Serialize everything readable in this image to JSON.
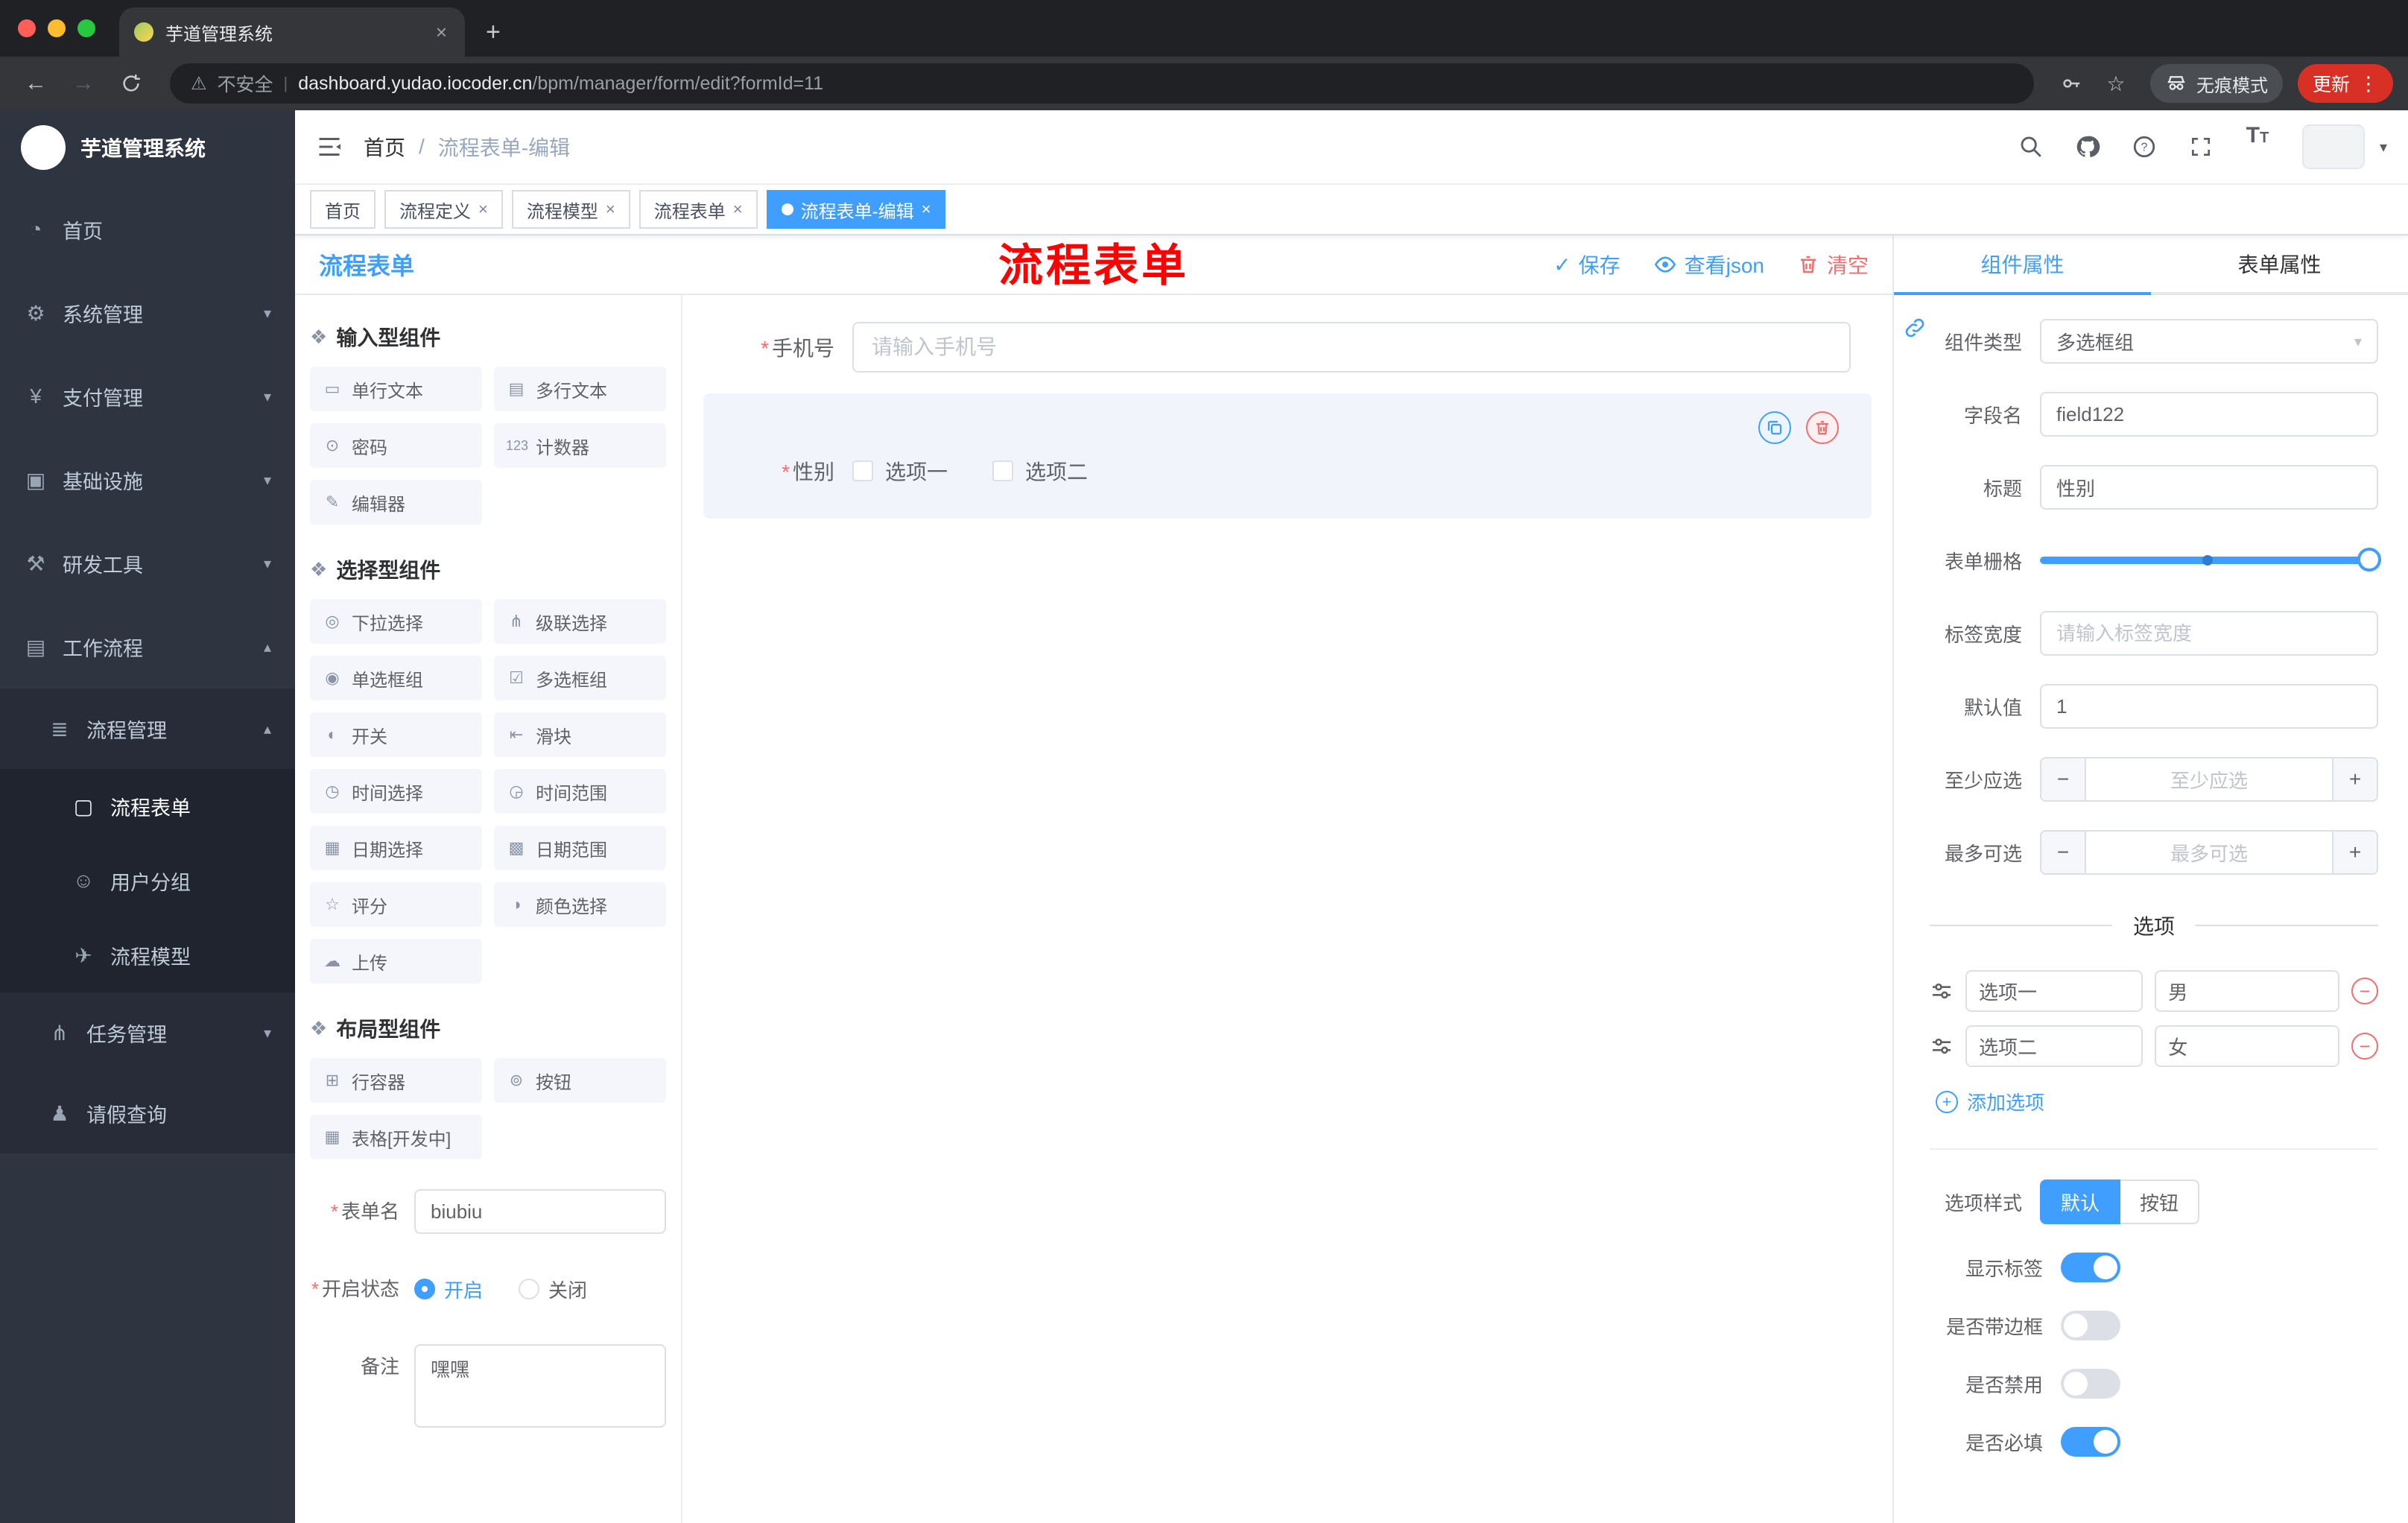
{
  "colors": {
    "accent": "#409EFF",
    "danger": "#F56C6C",
    "watermark_red": "#FF0000",
    "update_badge_red": "#D93025",
    "sidebar_bg": "#2E3440"
  },
  "ui": {
    "required": "*",
    "minus": "−",
    "plus": "+",
    "divider_bar": "|",
    "close": "×",
    "new_tab": "+",
    "dots": "⋮",
    "caret_down": "▾",
    "warning": "⚠",
    "back": "←",
    "forward": "→",
    "star": "☆",
    "check": "✓",
    "font_big": "T",
    "font_small": "T"
  },
  "browser": {
    "tab_title": "芋道管理系统",
    "security_label": "不安全",
    "url_domain": "dashboard.yudao.iocoder.cn",
    "url_path": "/bpm/manager/form/edit?formId=11",
    "incognito_label": "无痕模式",
    "update_label": "更新"
  },
  "sidebar": {
    "app_title": "芋道管理系统",
    "items": [
      {
        "label": "首页",
        "icon": "◔"
      },
      {
        "label": "系统管理",
        "icon": "⚙",
        "chevron": "▾"
      },
      {
        "label": "支付管理",
        "icon": "¥",
        "chevron": "▾"
      },
      {
        "label": "基础设施",
        "icon": "▣",
        "chevron": "▾"
      },
      {
        "label": "研发工具",
        "icon": "⚒",
        "chevron": "▾"
      },
      {
        "label": "工作流程",
        "icon": "▤",
        "chevron": "▴"
      },
      {
        "label": "流程管理",
        "icon": "≣",
        "chevron": "▴"
      },
      {
        "label": "流程表单",
        "icon": "▢"
      },
      {
        "label": "用户分组",
        "icon": "☺"
      },
      {
        "label": "流程模型",
        "icon": "✈"
      },
      {
        "label": "任务管理",
        "icon": "⋔",
        "chevron": "▾"
      },
      {
        "label": "请假查询",
        "icon": "♟"
      }
    ]
  },
  "header": {
    "breadcrumb_home": "首页",
    "breadcrumb_sep": "/",
    "breadcrumb_current": "流程表单-编辑",
    "watermark": "流程表单"
  },
  "tags": [
    {
      "label": "首页"
    },
    {
      "label": "流程定义"
    },
    {
      "label": "流程模型"
    },
    {
      "label": "流程表单"
    },
    {
      "label": "流程表单-编辑"
    }
  ],
  "designer": {
    "title": "流程表单",
    "save": "保存",
    "view_json": "查看json",
    "clear": "清空",
    "groups": [
      {
        "title": "输入型组件",
        "icon": "❖",
        "items": [
          {
            "label": "单行文本",
            "icon": "▭"
          },
          {
            "label": "多行文本",
            "icon": "▤"
          },
          {
            "label": "密码",
            "icon": "⊙"
          },
          {
            "label": "计数器",
            "icon": "123"
          },
          {
            "label": "编辑器",
            "icon": "✎"
          }
        ]
      },
      {
        "title": "选择型组件",
        "icon": "❖",
        "items": [
          {
            "label": "下拉选择",
            "icon": "◎"
          },
          {
            "label": "级联选择",
            "icon": "⋔"
          },
          {
            "label": "单选框组",
            "icon": "◉"
          },
          {
            "label": "多选框组",
            "icon": "☑"
          },
          {
            "label": "开关",
            "icon": "◐"
          },
          {
            "label": "滑块",
            "icon": "⇤"
          },
          {
            "label": "时间选择",
            "icon": "◷"
          },
          {
            "label": "时间范围",
            "icon": "◶"
          },
          {
            "label": "日期选择",
            "icon": "▦"
          },
          {
            "label": "日期范围",
            "icon": "▩"
          },
          {
            "label": "评分",
            "icon": "☆"
          },
          {
            "label": "颜色选择",
            "icon": "◑"
          },
          {
            "label": "上传",
            "icon": "☁"
          }
        ]
      },
      {
        "title": "布局型组件",
        "icon": "❖",
        "items": [
          {
            "label": "行容器",
            "icon": "⊞"
          },
          {
            "label": "按钮",
            "icon": "⊚"
          },
          {
            "label": "表格[开发中]",
            "icon": "▦"
          }
        ]
      }
    ],
    "meta": {
      "name_label": "表单名",
      "name_value": "biubiu",
      "status_label": "开启状态",
      "status_on": "开启",
      "status_off": "关闭",
      "remark_label": "备注",
      "remark_value": "嘿嘿"
    },
    "canvas": {
      "phone_label": "手机号",
      "phone_placeholder": "请输入手机号",
      "gender_label": "性别",
      "gender_option1": "选项一",
      "gender_option2": "选项二"
    }
  },
  "properties": {
    "tab_component": "组件属性",
    "tab_form": "表单属性",
    "rows": {
      "type_label": "组件类型",
      "type_value": "多选框组",
      "field_label": "字段名",
      "field_value": "field122",
      "title_label": "标题",
      "title_value": "性别",
      "grid_label": "表单栅格",
      "width_label": "标签宽度",
      "width_placeholder": "请输入标签宽度",
      "default_label": "默认值",
      "default_value": "1",
      "min_label": "至少应选",
      "min_placeholder": "至少应选",
      "max_label": "最多可选",
      "max_placeholder": "最多可选"
    },
    "options": {
      "divider_title": "选项",
      "rows": [
        {
          "label": "选项一",
          "value": "男"
        },
        {
          "label": "选项二",
          "value": "女"
        }
      ],
      "add_label": "添加选项"
    },
    "style": {
      "label": "选项样式",
      "seg_default": "默认",
      "seg_button": "按钮"
    },
    "switches": {
      "show_label": "显示标签",
      "border_label": "是否带边框",
      "disabled_label": "是否禁用",
      "required_label": "是否必填"
    }
  }
}
